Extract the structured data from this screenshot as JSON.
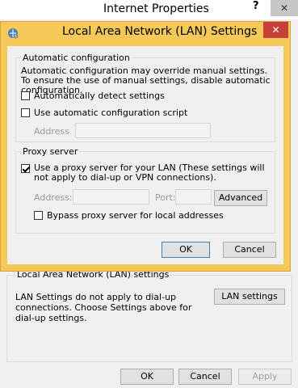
{
  "parent_window": {
    "title": "Internet Properties",
    "help_label": "?",
    "close_label": "✕",
    "lan_group": {
      "legend": "Local Area Network (LAN) settings",
      "text": "LAN Settings do not apply to dial-up connections. Choose Settings above for dial-up settings.",
      "button_label": "LAN settings"
    },
    "buttons": {
      "ok": "OK",
      "cancel": "Cancel",
      "apply": "Apply"
    }
  },
  "dialog": {
    "title": "Local Area Network (LAN) Settings",
    "close_label": "✕",
    "auto_config": {
      "legend": "Automatic configuration",
      "description": "Automatic configuration may override manual settings.  To ensure the use of manual settings, disable automatic configuration.",
      "auto_detect": {
        "label": "Automatically detect settings",
        "checked": false
      },
      "use_script": {
        "label": "Use automatic configuration script",
        "checked": false
      },
      "address_label": "Address",
      "address_value": ""
    },
    "proxy_server": {
      "legend": "Proxy server",
      "use_proxy": {
        "label": "Use a proxy server for your LAN (These settings will not apply to dial-up or VPN connections).",
        "checked": true
      },
      "address_label": "Address:",
      "address_value": "",
      "port_label": "Port:",
      "port_value": "",
      "advanced_label": "Advanced",
      "bypass": {
        "label": "Bypass proxy server for local addresses",
        "checked": false
      }
    },
    "buttons": {
      "ok": "OK",
      "cancel": "Cancel"
    }
  },
  "colors": {
    "dialog_frame": "#f5c85a",
    "close_button": "#c8403a"
  }
}
